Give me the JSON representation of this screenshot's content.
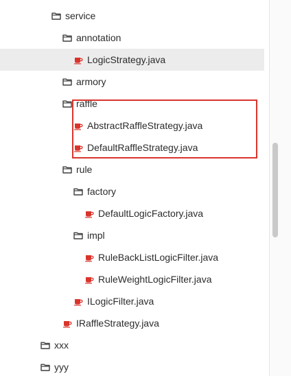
{
  "colors": {
    "folder_stroke": "#3d3d3d",
    "java_cup": "#d9342b",
    "selection_bg": "#ececec",
    "highlight_border": "#d9342b",
    "text": "#2b2b2b"
  },
  "tree": [
    {
      "label": "service",
      "type": "folder",
      "depth": 3
    },
    {
      "label": "annotation",
      "type": "folder",
      "depth": 4
    },
    {
      "label": "LogicStrategy.java",
      "type": "java",
      "depth": 5,
      "selected": true
    },
    {
      "label": "armory",
      "type": "folder",
      "depth": 4
    },
    {
      "label": "raffle",
      "type": "folder",
      "depth": 4
    },
    {
      "label": "AbstractRaffleStrategy.java",
      "type": "java",
      "depth": 5
    },
    {
      "label": "DefaultRaffleStrategy.java",
      "type": "java",
      "depth": 5
    },
    {
      "label": "rule",
      "type": "folder",
      "depth": 4
    },
    {
      "label": "factory",
      "type": "folder",
      "depth": 5
    },
    {
      "label": "DefaultLogicFactory.java",
      "type": "java",
      "depth": 6
    },
    {
      "label": "impl",
      "type": "folder",
      "depth": 5
    },
    {
      "label": "RuleBackListLogicFilter.java",
      "type": "java",
      "depth": 6
    },
    {
      "label": "RuleWeightLogicFilter.java",
      "type": "java",
      "depth": 6
    },
    {
      "label": "ILogicFilter.java",
      "type": "java",
      "depth": 5
    },
    {
      "label": "IRaffleStrategy.java",
      "type": "java",
      "depth": 4
    },
    {
      "label": "xxx",
      "type": "folder",
      "depth": 2
    },
    {
      "label": "yyy",
      "type": "folder",
      "depth": 2
    }
  ]
}
